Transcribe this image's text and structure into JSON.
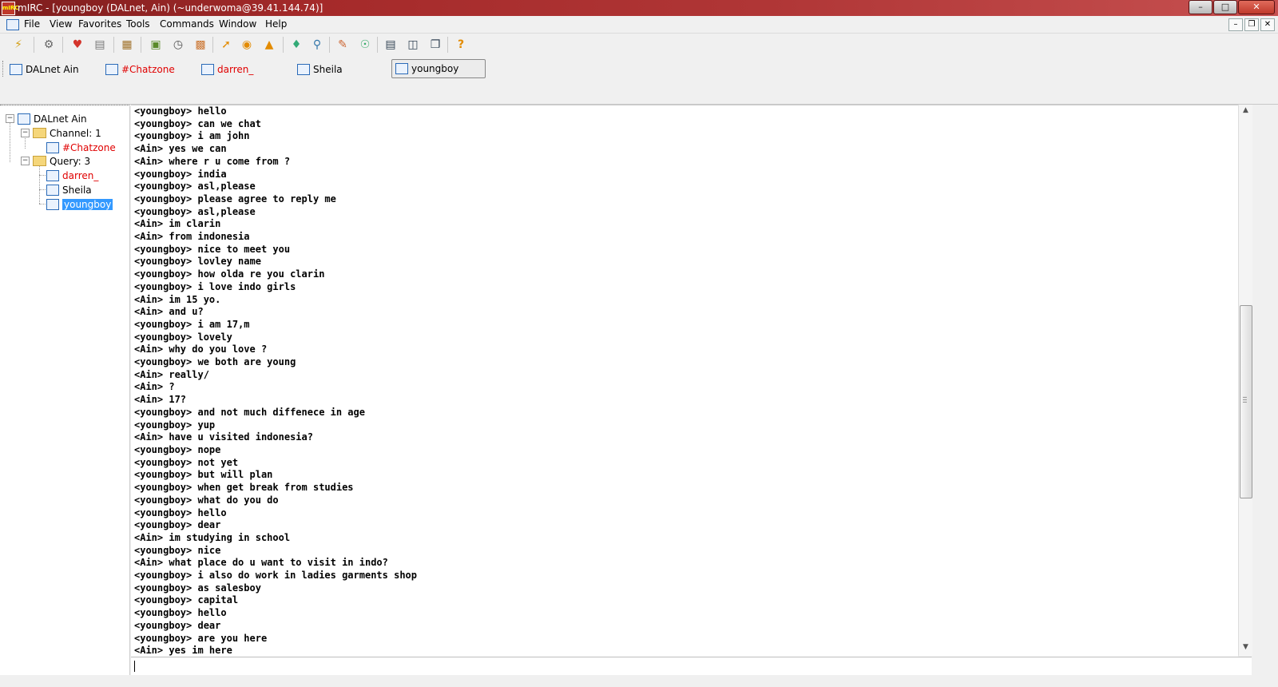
{
  "window": {
    "title": "mIRC - [youngboy (DALnet, Ain) (~underwoma@39.41.144.74)]",
    "app_icon": "mIRC",
    "buttons": {
      "minimize": "–",
      "maximize": "□",
      "close": "✕"
    }
  },
  "menu": {
    "items": [
      "File",
      "View",
      "Favorites",
      "Tools",
      "Commands",
      "Window",
      "Help"
    ],
    "mdi_buttons": {
      "minimize": "–",
      "restore": "❐",
      "close": "✕"
    }
  },
  "toolbar": {
    "icons": [
      "connect-icon",
      "options-icon",
      "favorites-icon",
      "organize-favorites-icon",
      "address-book-icon",
      "notify-list-icon",
      "timer-icon",
      "colors-icon",
      "dcc-send-icon",
      "dcc-chat-icon",
      "dcc-options-icon",
      "log-files-icon",
      "received-files-icon",
      "scripts-editor-icon",
      "url-list-icon",
      "tile-horizontal-icon",
      "tile-vertical-icon",
      "cascade-icon",
      "help-icon"
    ]
  },
  "switchbar": {
    "items": [
      {
        "label": "DALnet Ain",
        "type": "status",
        "color": "#000000"
      },
      {
        "label": "#Chatzone",
        "type": "channel",
        "color": "#e00000"
      },
      {
        "label": "darren_",
        "type": "query",
        "color": "#e00000"
      },
      {
        "label": "Sheila",
        "type": "query",
        "color": "#000000"
      },
      {
        "label": "youngboy",
        "type": "query",
        "color": "#000000",
        "active": true
      }
    ]
  },
  "tree": {
    "root": "DALnet Ain",
    "channel_group": "Channel: 1",
    "channels": [
      "#Chatzone"
    ],
    "query_group": "Query: 3",
    "queries": [
      "darren_",
      "Sheila",
      "youngboy"
    ],
    "selected": "youngboy"
  },
  "chat": {
    "lines": [
      "<youngboy> hello",
      "<youngboy> can we chat",
      "<youngboy> i am john",
      "<Ain> yes we can",
      "<Ain> where r u come from ?",
      "<youngboy> india",
      "<youngboy> asl,please",
      "<youngboy> please agree to reply me",
      "<youngboy> asl,please",
      "<Ain> im clarin",
      "<Ain> from indonesia",
      "<youngboy> nice to meet you",
      "<youngboy> lovley name",
      "<youngboy> how olda re you clarin",
      "<youngboy> i love indo girls",
      "<Ain> im 15 yo.",
      "<Ain> and u?",
      "<youngboy> i am 17,m",
      "<youngboy> lovely",
      "<Ain> why do you love ?",
      "<youngboy> we both are young",
      "<Ain> really/",
      "<Ain> ?",
      "<Ain> 17?",
      "<youngboy> and not much diffenece in age",
      "<youngboy> yup",
      "<Ain> have u visited indonesia?",
      "<youngboy> nope",
      "<youngboy> not yet",
      "<youngboy> but will plan",
      "<youngboy> when get break from studies",
      "<youngboy> what do you do",
      "<youngboy> hello",
      "<youngboy> dear",
      "<Ain> im studying in school",
      "<youngboy> nice",
      "<Ain> what place do u want to visit in indo?",
      "<youngboy> i also do work in ladies garments shop",
      "<youngboy> as salesboy",
      "<youngboy> capital",
      "<youngboy> hello",
      "<youngboy> dear",
      "<youngboy> are you here",
      "<Ain> yes im here"
    ]
  },
  "input": {
    "value": ""
  }
}
